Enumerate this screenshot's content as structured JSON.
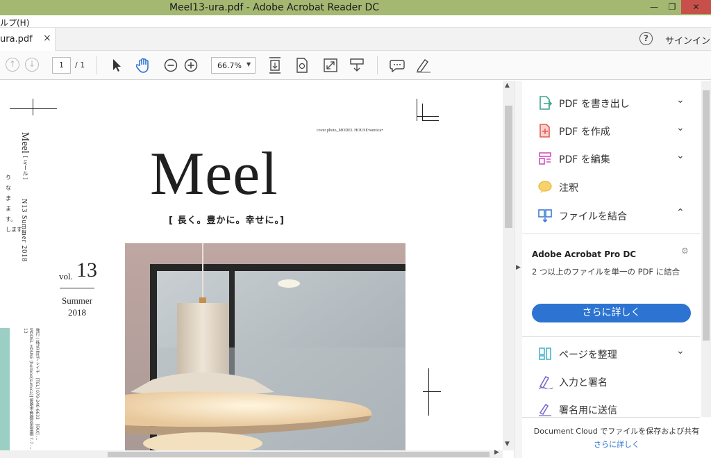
{
  "window": {
    "title": "Meel13-ura.pdf - Adobe Acrobat Reader DC",
    "minimize_glyph": "—",
    "maximize_glyph": "❐",
    "close_glyph": "✕"
  },
  "menu": {
    "visible_text": "ルプ(H)"
  },
  "tab": {
    "label": "ura.pdf",
    "close_glyph": "×"
  },
  "header": {
    "help_glyph": "?",
    "signin_label": "サインイン"
  },
  "toolbar": {
    "page_current": "1",
    "page_total": "/ 1",
    "zoom": "66.7%",
    "icons": [
      "prev-page-icon",
      "next-page-icon",
      "select-tool-icon",
      "hand-tool-icon",
      "zoom-out-icon",
      "zoom-in-icon",
      "fit-page-icon",
      "rotate-icon",
      "fullscreen-icon",
      "scroll-mode-icon",
      "comment-icon",
      "highlight-icon"
    ]
  },
  "document": {
    "cover_credit": "cover photo_MODEL HOUSE•sumica•",
    "logo": "Meel",
    "tagline": "[ 長く。豊かに。幸せに。]",
    "vol_label": "vol.",
    "vol_number": "13",
    "season": "Summer",
    "year": "2018",
    "side_title": "Meel",
    "side_title_kana": "[ ミール ]",
    "side_issue": "N13 Summer 2018",
    "side_publisher": "発行 / 株式会社アレイデ　[TEL] 079-240-6633　[FAX] ... MODEL HOUSE [hellooo(sumica)] 姫路市飾磨区思案橋 7-7 ... 13",
    "side_snippets": [
      "り",
      "な",
      "ま",
      "ま",
      "す。",
      "します。"
    ]
  },
  "rightpane": {
    "tools": [
      {
        "label": "PDF を書き出し",
        "icon": "export-pdf-icon",
        "expanded": false
      },
      {
        "label": "PDF を作成",
        "icon": "create-pdf-icon",
        "expanded": false
      },
      {
        "label": "PDF を編集",
        "icon": "edit-pdf-icon",
        "expanded": false
      },
      {
        "label": "注釈",
        "icon": "comment-tool-icon"
      },
      {
        "label": "ファイルを結合",
        "icon": "combine-files-icon",
        "expanded": true
      },
      {
        "label": "ページを整理",
        "icon": "organize-pages-icon",
        "expanded": false
      },
      {
        "label": "入力と署名",
        "icon": "fill-sign-icon"
      },
      {
        "label": "署名用に送信",
        "icon": "send-sign-icon"
      }
    ],
    "pro_title": "Adobe Acrobat Pro DC",
    "pro_desc": "2 つ以上のファイルを単一の PDF に結合",
    "more_button": "さらに詳しく",
    "cloud_text": "Document Cloud でファイルを保存および共有",
    "cloud_link": "さらに詳しく"
  },
  "colors": {
    "titlebar": "#a5b872",
    "close_button": "#c7504a",
    "accent_blue": "#2d74d2",
    "teal_bar": "#9ccfc4"
  }
}
